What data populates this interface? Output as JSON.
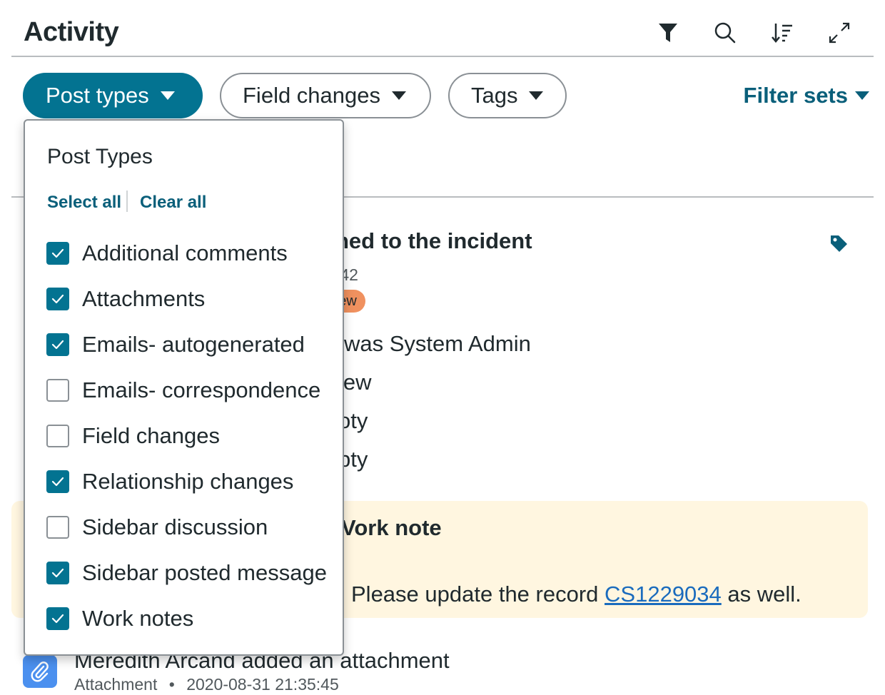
{
  "header": {
    "title": "Activity",
    "icons": [
      "filter-icon",
      "search-icon",
      "sort-icon",
      "expand-icon"
    ]
  },
  "filters": {
    "post_types": "Post types",
    "field_changes": "Field changes",
    "tags": "Tags",
    "filter_sets": "Filter sets"
  },
  "dropdown": {
    "heading": "Post Types",
    "select_all": "Select all",
    "clear_all": "Clear all",
    "options": [
      {
        "label": "Additional comments",
        "checked": true
      },
      {
        "label": "Attachments",
        "checked": true
      },
      {
        "label": "Emails- autogenerated",
        "checked": true
      },
      {
        "label": "Emails- correspondence",
        "checked": false
      },
      {
        "label": "Field changes",
        "checked": false
      },
      {
        "label": "Relationship changes",
        "checked": true
      },
      {
        "label": "Sidebar discussion",
        "checked": false
      },
      {
        "label": "Sidebar posted message",
        "checked": true
      },
      {
        "label": "Work notes",
        "checked": true
      }
    ]
  },
  "stream": {
    "entry1_title_fragment": "ned to the incident",
    "entry1_time_fragment": ":42",
    "entry1_badge_fragment": "ew",
    "entry1_lines": [
      "was System Admin",
      "lew",
      "oty",
      "pty"
    ],
    "worknote_title_fragment": "Vork note",
    "worknote_text_before": "Please update the record ",
    "worknote_link": "CS1229034",
    "worknote_text_after": " as well.",
    "attachment_title": "Meredith Arcand added an attachment",
    "attachment_type": "Attachment",
    "attachment_separator": "•",
    "attachment_time": "2020-08-31 21:35:45"
  },
  "colors": {
    "accent": "#037391",
    "link": "#1a6bbd",
    "badge_new": "#f0915f",
    "worknote_bg": "#fff6e0",
    "attachment_icon_bg": "#4b90ef"
  }
}
